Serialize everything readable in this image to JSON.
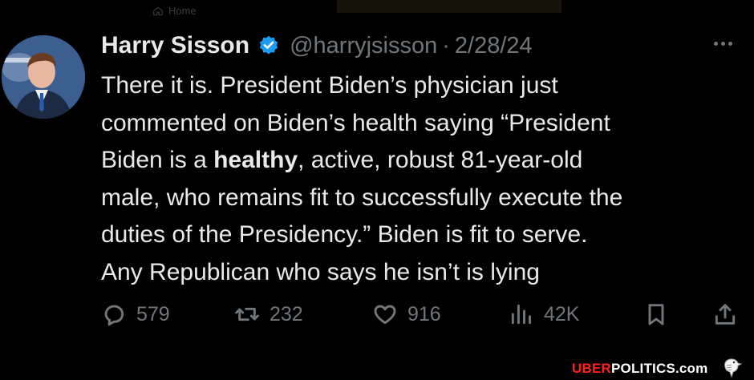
{
  "top": {
    "home_label": "Home"
  },
  "tweet": {
    "author": {
      "name": "Harry Sisson",
      "handle": "@harryjsisson",
      "separator": "·",
      "date": "2/28/24",
      "verified": true
    },
    "text_lines": [
      "There it is. President Biden’s physician just",
      "commented on Biden’s health saying “President",
      "Biden is a ",
      "healthy",
      ", active, robust 81-year-old",
      "male, who remains fit to successfully execute the",
      "duties of the Presidency.” Biden is fit to serve.",
      "Any Republican who says he isn’t is lying"
    ],
    "stats": {
      "replies": "579",
      "reposts": "232",
      "likes": "916",
      "views": "42K"
    },
    "icons": [
      "reply-icon",
      "repost-icon",
      "like-icon",
      "views-icon",
      "bookmark-icon",
      "share-icon",
      "more-icon",
      "verified-badge-icon"
    ]
  },
  "watermark": {
    "part1": "UBER",
    "part2": "POLITICS.com"
  },
  "colors": {
    "background": "#000000",
    "text": "#e7e9ea",
    "muted": "#71767b",
    "verified": "#1d9bf0",
    "brand_red": "#ff2020"
  }
}
